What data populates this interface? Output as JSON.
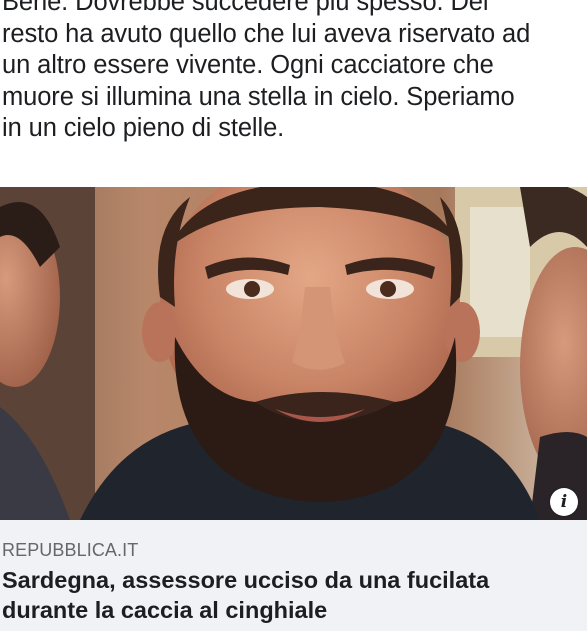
{
  "post": {
    "lines": [
      "Bene. Dovrebbe succedere più spesso. Del",
      "resto ha avuto quello che lui aveva riservato ad",
      "un altro essere vivente. Ogni cacciatore che",
      "muore si illumina una stella in cielo. Speriamo",
      "in un cielo pieno di stelle."
    ]
  },
  "link_preview": {
    "domain": "REPUBBLICA.IT",
    "headline_lines": [
      "Sardegna, assessore ucciso da una fucilata",
      "durante la caccia al cinghiale"
    ],
    "info_icon": "info-icon",
    "info_glyph": "i"
  },
  "colors": {
    "text": "#1c1e21",
    "secondary_text": "#65676b",
    "card_background": "#f0f2f5"
  }
}
